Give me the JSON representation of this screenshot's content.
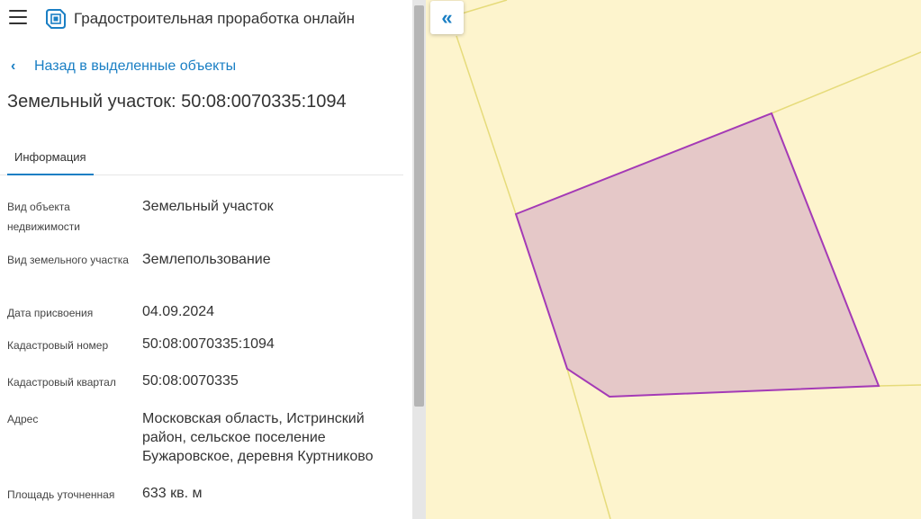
{
  "app": {
    "title": "Градостроительная проработка онлайн"
  },
  "nav": {
    "back_label": "Назад в выделенные объекты",
    "collapse_symbol": "«"
  },
  "object": {
    "title": "Земельный участок: 50:08:0070335:1094"
  },
  "tabs": [
    {
      "label": "Информация",
      "active": true
    }
  ],
  "info_rows": [
    {
      "label": "Вид объекта недвижимости",
      "value": "Земельный участок"
    },
    {
      "label": "Вид земельного участка",
      "value": "Землепользование"
    },
    {
      "label": "Дата присвоения",
      "value": "04.09.2024"
    },
    {
      "label": "Кадастровый номер",
      "value": "50:08:0070335:1094"
    },
    {
      "label": "Кадастровый квартал",
      "value": "50:08:0070335"
    },
    {
      "label": "Адрес",
      "value": "Московская область, Истринский район, сельское поселение Бужаровское, деревня Куртниково"
    },
    {
      "label": "Площадь уточненная",
      "value": "633 кв. м"
    }
  ],
  "colors": {
    "accent": "#1a7fc4",
    "map_background": "#fdf4cd",
    "parcel_fill": "#e5c8c8",
    "parcel_stroke": "#a43ab6",
    "neighbor_line": "#e6db7a"
  },
  "icons": {
    "menu": "hamburger-icon",
    "logo": "app-logo-icon",
    "back": "chevron-left-icon",
    "collapse": "double-chevron-left-icon"
  }
}
